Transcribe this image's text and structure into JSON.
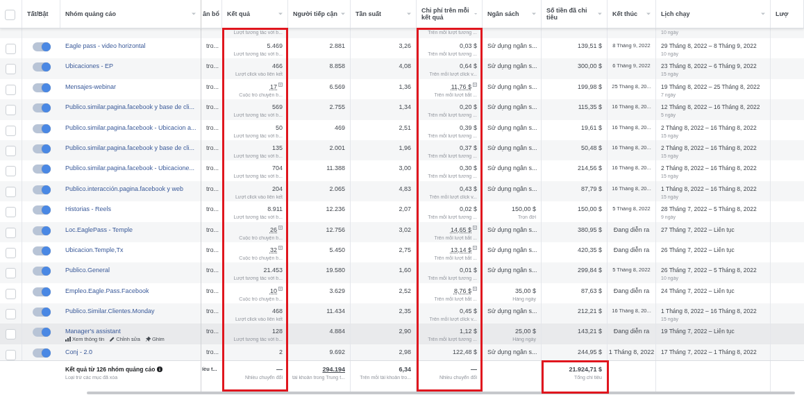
{
  "select_all": {
    "selected": false
  },
  "columns": [
    {
      "label": "Tất/Bật"
    },
    {
      "label": "Nhóm quảng cáo"
    },
    {
      "label": "ân bổ"
    },
    {
      "label": "Kết quả",
      "highlighted": true
    },
    {
      "label": "Người tiếp cận"
    },
    {
      "label": "Tần suất"
    },
    {
      "label": "Chi phí trên mỗi kết quả",
      "highlighted": true
    },
    {
      "label": "Ngân sách"
    },
    {
      "label": "Số tiền đã chi tiêu"
    },
    {
      "label": "Kết thúc"
    },
    {
      "label": "Lịch chạy"
    },
    {
      "label": "Lượ"
    }
  ],
  "rows": [
    {
      "kind": "partial",
      "result_note": "Lượt tương tác với b...",
      "cost_note": "Trên mỗi lượt tương ...",
      "duration": "10 ngày"
    },
    {
      "kind": "full",
      "selected": false,
      "on": true,
      "hovered": false,
      "name": "Eagle pass - video horizontal",
      "delivery": "tro...",
      "result": "5.469",
      "result_note": "Lượt tương tác với b...",
      "attributed": false,
      "reach": "2.881",
      "frequency": "3,26",
      "cost": "0,03 $",
      "cost_note": "Trên mỗi lượt tương ...",
      "budget": "Sử dụng ngân s...",
      "spent": "139,51 $",
      "end": "8 Tháng 9, 2022",
      "schedule": "29 Tháng 8, 2022 – 8 Tháng 9, 2022",
      "duration": "10 ngày"
    },
    {
      "kind": "full",
      "selected": false,
      "on": true,
      "hovered": false,
      "name": "Ubicaciones - EP",
      "delivery": "tro...",
      "result": "466",
      "result_note": "Lượt click vào liên kết",
      "attributed": false,
      "reach": "8.858",
      "frequency": "4,08",
      "cost": "0,64 $",
      "cost_note": "Trên mỗi lượt click v...",
      "budget": "Sử dụng ngân s...",
      "spent": "300,00 $",
      "end": "6 Tháng 9, 2022",
      "schedule": "23 Tháng 8, 2022 – 6 Tháng 9, 2022",
      "duration": "15 ngày"
    },
    {
      "kind": "full",
      "selected": false,
      "on": true,
      "hovered": false,
      "name": "Mensajes-webinar",
      "delivery": "tro...",
      "result": "17",
      "result_note": "Cuộc trò chuyện b...",
      "attributed": true,
      "reach": "6.569",
      "frequency": "1,36",
      "cost": "11,76 $",
      "cost_note": "Trên mỗi lượt bắt ...",
      "budget": "Sử dụng ngân s...",
      "spent": "199,98 $",
      "end": "25 Tháng 8, 20...",
      "schedule": "19 Tháng 8, 2022 – 25 Tháng 8, 2022",
      "duration": "7 ngày"
    },
    {
      "kind": "full",
      "selected": false,
      "on": true,
      "hovered": false,
      "name": "Publico.similar.pagina.facebook y base de cli...",
      "delivery": "tro...",
      "result": "569",
      "result_note": "Lượt tương tác với b...",
      "attributed": false,
      "reach": "2.755",
      "frequency": "1,34",
      "cost": "0,20 $",
      "cost_note": "Trên mỗi lượt tương ...",
      "budget": "Sử dụng ngân s...",
      "spent": "115,35 $",
      "end": "16 Tháng 8, 20...",
      "schedule": "12 Tháng 8, 2022 – 16 Tháng 8, 2022",
      "duration": "5 ngày"
    },
    {
      "kind": "full",
      "selected": false,
      "on": true,
      "hovered": false,
      "name": "Publico.similar.pagina.facebook - Ubicacion a...",
      "delivery": "tro...",
      "result": "50",
      "result_note": "Lượt tương tác với b...",
      "attributed": false,
      "reach": "469",
      "frequency": "2,51",
      "cost": "0,39 $",
      "cost_note": "Trên mỗi lượt tương ...",
      "budget": "Sử dụng ngân s...",
      "spent": "19,61 $",
      "end": "16 Tháng 8, 20...",
      "schedule": "2 Tháng 8, 2022 – 16 Tháng 8, 2022",
      "duration": "15 ngày"
    },
    {
      "kind": "full",
      "selected": false,
      "on": true,
      "hovered": false,
      "name": "Publico.similar.pagina.facebook y base de cli...",
      "delivery": "tro...",
      "result": "135",
      "result_note": "Lượt tương tác với b...",
      "attributed": false,
      "reach": "2.001",
      "frequency": "1,96",
      "cost": "0,37 $",
      "cost_note": "Trên mỗi lượt tương ...",
      "budget": "Sử dụng ngân s...",
      "spent": "50,48 $",
      "end": "16 Tháng 8, 20...",
      "schedule": "2 Tháng 8, 2022 – 16 Tháng 8, 2022",
      "duration": "15 ngày"
    },
    {
      "kind": "full",
      "selected": false,
      "on": true,
      "hovered": false,
      "name": "Publico.similar.pagina.facebook - Ubicacione...",
      "delivery": "tro...",
      "result": "704",
      "result_note": "Lượt tương tác với b...",
      "attributed": false,
      "reach": "11.388",
      "frequency": "3,00",
      "cost": "0,30 $",
      "cost_note": "Trên mỗi lượt tương ...",
      "budget": "Sử dụng ngân s...",
      "spent": "214,56 $",
      "end": "16 Tháng 8, 20...",
      "schedule": "2 Tháng 8, 2022 – 16 Tháng 8, 2022",
      "duration": "15 ngày"
    },
    {
      "kind": "full",
      "selected": false,
      "on": true,
      "hovered": false,
      "name": "Publico.interacción.pagina.facebook y web",
      "delivery": "tro...",
      "result": "204",
      "result_note": "Lượt click vào liên kết",
      "attributed": false,
      "reach": "2.065",
      "frequency": "4,83",
      "cost": "0,43 $",
      "cost_note": "Trên mỗi lượt click v...",
      "budget": "Sử dụng ngân s...",
      "spent": "87,79 $",
      "end": "16 Tháng 8, 20...",
      "schedule": "1 Tháng 8, 2022 – 16 Tháng 8, 2022",
      "duration": "15 ngày"
    },
    {
      "kind": "full",
      "selected": false,
      "on": true,
      "hovered": false,
      "name": "Historias - Reels",
      "delivery": "tro...",
      "result": "8.911",
      "result_note": "Lượt tương tác với b...",
      "attributed": false,
      "reach": "12.236",
      "frequency": "2,07",
      "cost": "0,02 $",
      "cost_note": "Trên mỗi lượt tương ...",
      "budget": "150,00 $",
      "budget_note": "Trọn đời",
      "spent": "150,00 $",
      "end": "5 Tháng 8, 2022",
      "schedule": "28 Tháng 7, 2022 – 5 Tháng 8, 2022",
      "duration": "9 ngày"
    },
    {
      "kind": "full",
      "selected": false,
      "on": true,
      "hovered": false,
      "name": "Loc.EaglePass - Temple",
      "delivery": "tro...",
      "result": "26",
      "result_note": "Cuộc trò chuyện b...",
      "attributed": true,
      "reach": "12.756",
      "frequency": "3,02",
      "cost": "14,65 $",
      "cost_note": "Trên mỗi lượt bắt ...",
      "budget": "Sử dụng ngân s...",
      "spent": "380,95 $",
      "end": "Đang diễn ra",
      "schedule": "27 Tháng 7, 2022 – Liên tục"
    },
    {
      "kind": "full",
      "selected": false,
      "on": true,
      "hovered": false,
      "name": "Ubicacion.Temple,Tx",
      "delivery": "tro...",
      "result": "32",
      "result_note": "Cuộc trò chuyện b...",
      "attributed": true,
      "reach": "5.450",
      "frequency": "2,75",
      "cost": "13,14 $",
      "cost_note": "Trên mỗi lượt bắt ...",
      "budget": "Sử dụng ngân s...",
      "spent": "420,35 $",
      "end": "Đang diễn ra",
      "schedule": "26 Tháng 7, 2022 – Liên tục"
    },
    {
      "kind": "full",
      "selected": false,
      "on": true,
      "hovered": false,
      "name": "Publico.General",
      "delivery": "tro...",
      "result": "21.453",
      "result_note": "Lượt tương tác với b...",
      "attributed": false,
      "reach": "19.580",
      "frequency": "1,60",
      "cost": "0,01 $",
      "cost_note": "Trên mỗi lượt tương ...",
      "budget": "Sử dụng ngân s...",
      "spent": "299,84 $",
      "end": "5 Tháng 8, 2022",
      "schedule": "26 Tháng 7, 2022 – 5 Tháng 8, 2022",
      "duration": "10 ngày"
    },
    {
      "kind": "full",
      "selected": false,
      "on": true,
      "hovered": false,
      "name": "Empleo.Eagle.Pass.Facebook",
      "delivery": "tro...",
      "result": "10",
      "result_note": "Cuộc trò chuyện b...",
      "attributed": true,
      "reach": "3.629",
      "frequency": "2,52",
      "cost": "8,76 $",
      "cost_note": "Trên mỗi lượt bắt ...",
      "budget": "35,00 $",
      "budget_note": "Hàng ngày",
      "spent": "87,63 $",
      "end": "Đang diễn ra",
      "schedule": "24 Tháng 7, 2022 – Liên tục"
    },
    {
      "kind": "full",
      "selected": false,
      "on": true,
      "hovered": false,
      "name": "Publico.Similar.Clientes.Monday",
      "delivery": "tro...",
      "result": "468",
      "result_note": "Lượt click vào liên kết",
      "attributed": false,
      "reach": "11.434",
      "frequency": "2,35",
      "cost": "0,45 $",
      "cost_note": "Trên mỗi lượt click v...",
      "budget": "Sử dụng ngân s...",
      "spent": "212,21 $",
      "end": "16 Tháng 8, 20...",
      "schedule": "1 Tháng 8, 2022 – 16 Tháng 8, 2022",
      "duration": "15 ngày"
    },
    {
      "kind": "full",
      "selected": false,
      "on": true,
      "hovered": true,
      "name": "Manager's assistant",
      "actions": [
        {
          "kind": "chart",
          "label": "Xem thông tin"
        },
        {
          "kind": "pencil",
          "label": "Chỉnh sửa"
        },
        {
          "kind": "pin",
          "label": "Ghim"
        }
      ],
      "delivery": "tro...",
      "result": "128",
      "result_note": "Lượt tương tác với b...",
      "attributed": false,
      "reach": "4.884",
      "frequency": "2,90",
      "cost": "1,12 $",
      "cost_note": "Trên mỗi lượt tương ...",
      "budget": "25,00 $",
      "budget_note": "Hàng ngày",
      "spent": "143,21 $",
      "end": "Đang diễn ra",
      "schedule": "19 Tháng 7, 2022 – Liên tục"
    },
    {
      "kind": "full",
      "selected": false,
      "on": true,
      "hovered": false,
      "name": "Conj - 2.0",
      "delivery": "tro...",
      "result": "2",
      "attributed": false,
      "reach": "9.692",
      "frequency": "2,98",
      "cost": "122,48 $",
      "budget": "Sử dụng ngân s...",
      "spent": "244,95 $",
      "end": "1 Tháng 8, 2022",
      "schedule": "17 Tháng 7, 2022 – 1 Tháng 8, 2022"
    }
  ],
  "footer": {
    "title": "Kết quả từ 126 nhóm quảng cáo",
    "subtitle": "Loại trừ các mục đã xóa",
    "delivery": "iều t...",
    "result": "—",
    "result_note": "Nhiều chuyển đổi",
    "reach": "294.194",
    "reach_note": "tài khoản trong Trung t...",
    "frequency": "6,34",
    "frequency_note": "Trên mỗi tài khoản tro...",
    "cost": "—",
    "cost_note": "Nhiều chuyển đổi",
    "spent": "21.924,71 $",
    "spent_note": "Tổng chi tiêu",
    "spent_highlighted": true
  }
}
